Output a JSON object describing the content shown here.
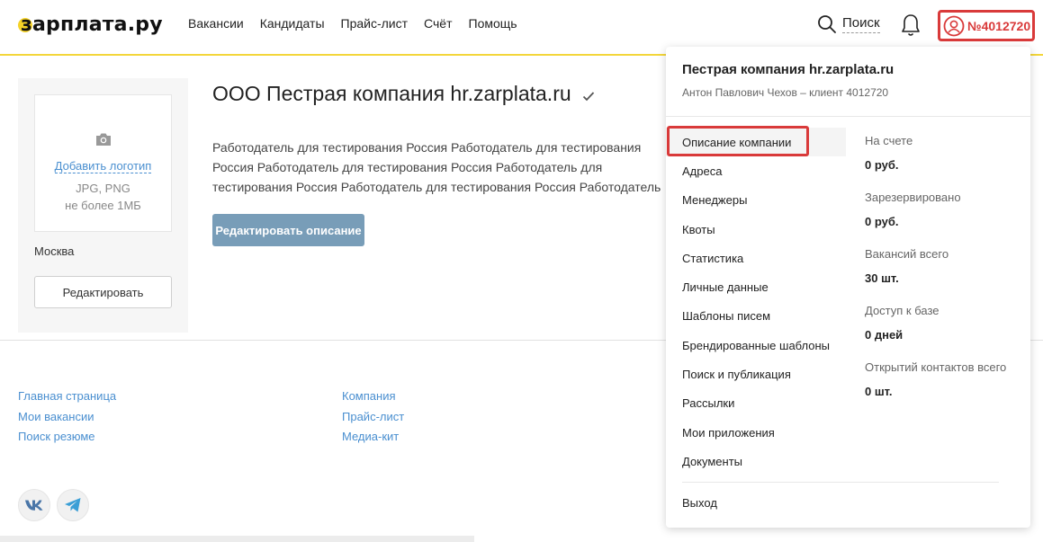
{
  "header": {
    "logo_text": "зарплата.ру",
    "nav": [
      "Вакансии",
      "Кандидаты",
      "Прайс-лист",
      "Счёт",
      "Помощь"
    ],
    "search_label": "Поиск",
    "account_number": "№4012720",
    "accent_color": "#f3d63a",
    "highlight_color": "#d93a3a"
  },
  "sidebar": {
    "add_logo": "Добавить логотип",
    "logo_format": "JPG, PNG",
    "logo_size": "не более 1МБ",
    "city": "Москва",
    "edit_button": "Редактировать"
  },
  "company": {
    "title": "ООО Пестрая компания hr.zarplata.ru",
    "description": "Работодатель для тестирования Россия Работодатель для тестирования Россия Работодатель для тестирования Россия Работодатель для тестирования Россия Работодатель для тестирования Россия Работодатель для тестирования Россия Работодатель для тестирования",
    "edit_description_button": "Редактировать описание"
  },
  "footer": {
    "col1": [
      "Главная страница",
      "Мои вакансии",
      "Поиск резюме"
    ],
    "col2": [
      "Компания",
      "Прайс-лист",
      "Медиа-кит"
    ],
    "social_icons": [
      "vk-icon",
      "telegram-icon"
    ]
  },
  "dropdown": {
    "company_name": "Пестрая компания hr.zarplata.ru",
    "client_line": "Антон Павлович Чехов – клиент 4012720",
    "menu": [
      "Описание компании",
      "Адреса",
      "Менеджеры",
      "Квоты",
      "Статистика",
      "Личные данные",
      "Шаблоны писем",
      "Брендированные шаблоны",
      "Поиск и публикация",
      "Рассылки",
      "Мои приложения",
      "Документы"
    ],
    "stats": [
      {
        "label": "На счете",
        "value": "0 руб."
      },
      {
        "label": "Зарезервировано",
        "value": "0 руб."
      },
      {
        "label": "Вакансий всего",
        "value": "30 шт."
      },
      {
        "label": "Доступ к базе",
        "value": "0 дней"
      },
      {
        "label": "Открытий контактов всего",
        "value": "0 шт."
      }
    ],
    "logout": "Выход"
  }
}
